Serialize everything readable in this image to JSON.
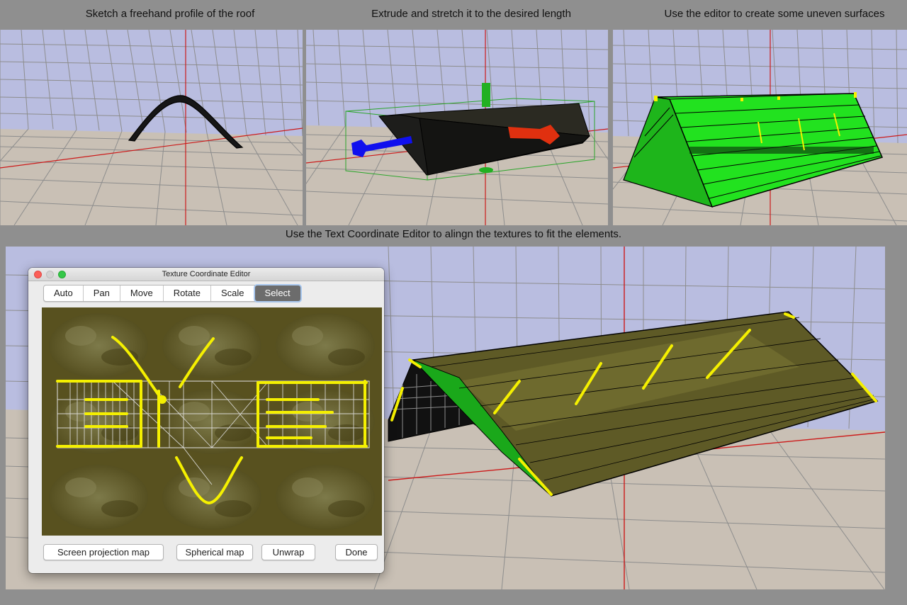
{
  "captions": {
    "step1": "Sketch a freehand profile of the roof",
    "step2": "Extrude and stretch it to the desired length",
    "step3": "Use the editor to create some uneven surfaces",
    "step4": "Use the Text Coordinate Editor to alingn the textures to fit the elements."
  },
  "editor": {
    "title": "Texture Coordinate Editor",
    "tools": [
      "Auto",
      "Pan",
      "Move",
      "Rotate",
      "Scale",
      "Select"
    ],
    "active_tool": "Select",
    "buttons": {
      "screen_projection": "Screen projection map",
      "spherical": "Spherical map",
      "unwrap": "Unwrap",
      "done": "Done"
    }
  },
  "colors": {
    "viewport_bg": "#b9bde0",
    "ground": "#c9c0b5",
    "grid": "#8d8d8d",
    "axis": "#cc1a1a",
    "mesh_green": "#22e21f",
    "selection_yellow": "#f5f000",
    "texture_olive": "#6b6226",
    "arrow_blue": "#1010ee",
    "arrow_red": "#e0300f"
  }
}
